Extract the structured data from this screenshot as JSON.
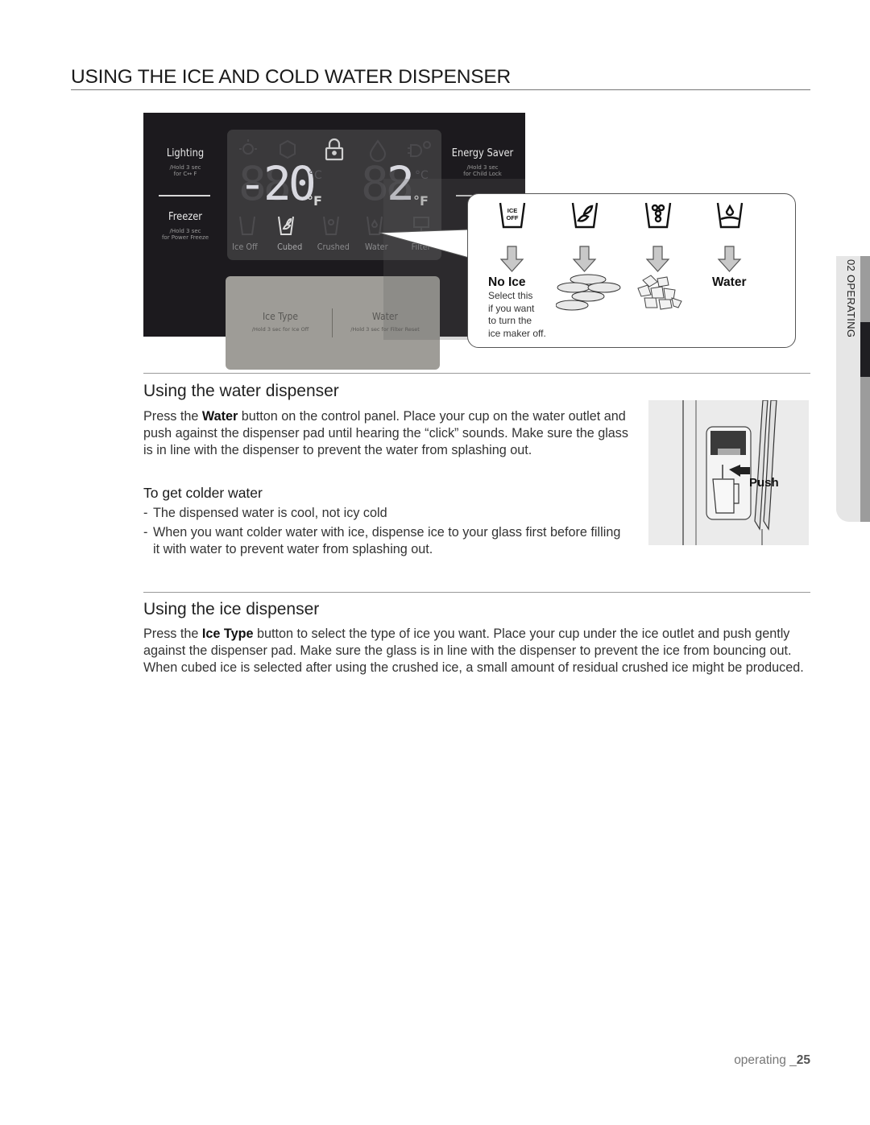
{
  "page": {
    "title": "USING THE ICE AND COLD WATER DISPENSER",
    "footer_section": "operating _",
    "footer_page": "25",
    "side_tab": "02 OPERATING"
  },
  "control_panel": {
    "left_buttons": [
      {
        "label": "Lighting",
        "sub1": "/Hold 3 sec",
        "sub2": "for  C↔ F"
      },
      {
        "label": "Freezer",
        "sub1": "/Hold 3 sec",
        "sub2": "for Power Freeze"
      }
    ],
    "right_buttons": [
      {
        "label": "Energy Saver",
        "sub1": "/Hold 3 sec",
        "sub2": "for Child Lock"
      }
    ],
    "freezer_temp": "-20",
    "fridge_temp": "2",
    "temp_unit": "°F",
    "temp_unit_alt": "°C",
    "status_icons": [
      "lighting-icon",
      "power-freeze-icon",
      "lock-icon",
      "power-cool-icon",
      "energy-saver-icon"
    ],
    "active_status_icon": "lock-icon",
    "modes": [
      {
        "label": "Ice Off",
        "icon": "ice-off-cup-icon",
        "active": false
      },
      {
        "label": "Cubed",
        "icon": "cubed-ice-cup-icon",
        "active": true
      },
      {
        "label": "Crushed",
        "icon": "crushed-ice-cup-icon",
        "active": false
      },
      {
        "label": "Water",
        "icon": "water-cup-icon",
        "active": false
      },
      {
        "label": "Filter",
        "icon": "filter-icon",
        "active": false
      }
    ],
    "lower_buttons": [
      {
        "label": "Ice Type",
        "sub": "/Hold 3 sec for Ice Off"
      },
      {
        "label": "Water",
        "sub": "/Hold 3 sec for Filter Reset"
      }
    ]
  },
  "callout": {
    "ice_off_icon_text_1": "ICE",
    "ice_off_icon_text_2": "OFF",
    "options": [
      {
        "name": "No Ice",
        "icon": "ice-off-cup-icon",
        "result": "no-ice"
      },
      {
        "name": "Cubed",
        "icon": "cubed-ice-cup-icon",
        "result": "ice-cubes-image"
      },
      {
        "name": "Crushed",
        "icon": "crushed-ice-cup-icon",
        "result": "crushed-ice-image"
      },
      {
        "name": "Water",
        "icon": "water-cup-icon",
        "result": "water"
      }
    ],
    "no_ice_label": "No Ice",
    "no_ice_desc": [
      "Select this",
      "if you want",
      "to turn the",
      "ice maker off."
    ],
    "water_label": "Water"
  },
  "water_section": {
    "heading": "Using the water dispenser",
    "para_pre": "Press the ",
    "para_bold": "Water",
    "para_post": " button on the control panel. Place your cup on the water outlet and push against the dispenser pad until hearing the “click” sounds. Make sure the glass is in line with the dispenser to prevent the water from splashing out.",
    "subheading": "To get colder water",
    "bullets": [
      "The dispensed water is cool, not icy cold",
      "When you want colder water with ice, dispense ice to your glass first before filling it with water to prevent water from splashing out."
    ],
    "image_label": "Push"
  },
  "ice_section": {
    "heading": "Using the ice dispenser",
    "para_pre": "Press the ",
    "para_bold": "Ice Type",
    "para_post": " button to select the type of ice you want. Place your cup under the ice outlet and push gently against the dispenser pad. Make sure the glass is in line with the dispenser to prevent the ice from bouncing out. When cubed ice is selected after using the crushed ice, a small amount of residual crushed ice might be produced."
  }
}
